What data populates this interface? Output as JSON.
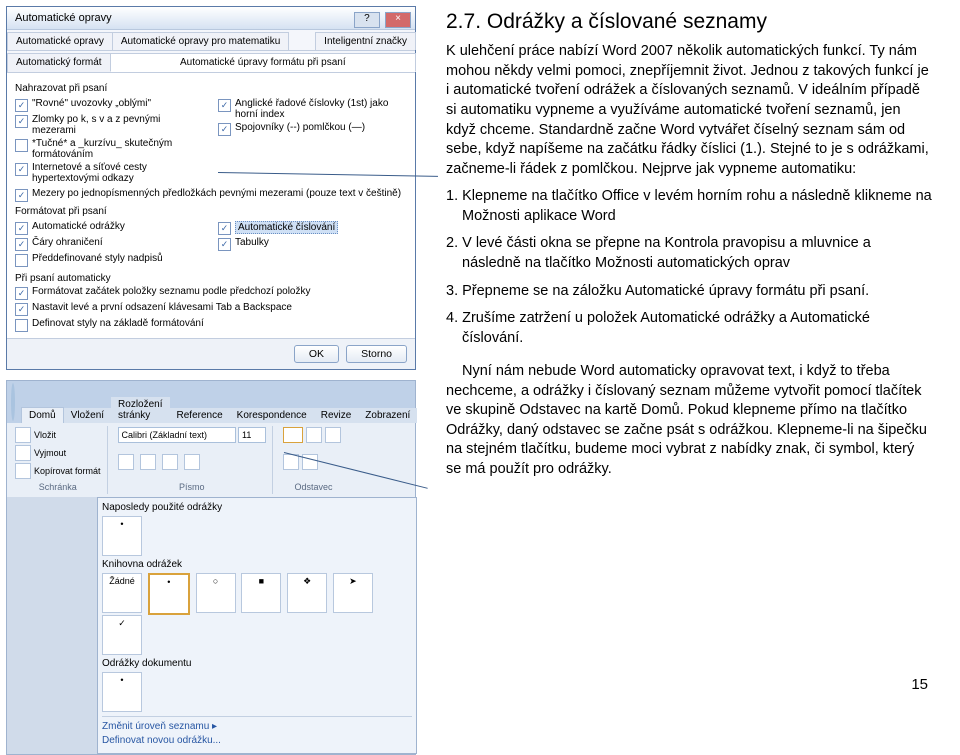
{
  "heading": "2.7. Odrážky a číslované seznamy",
  "para1": "K ulehčení práce nabízí Word 2007 několik automatických funkcí. Ty nám mohou někdy velmi pomoci, znepříjemnit život. Jednou z takových funkcí je i automatické tvoření odrážek a číslovaných seznamů. V ideálním případě si automatiku vypneme a využíváme automatické tvoření seznamů, jen když chceme. Standardně začne Word vytvářet číselný seznam sám od sebe, když napíšeme na začátku řádky číslici (1.). Stejné to je s odrážkami, začneme-li řádek z pomlčkou. Nejprve jak vypneme automatiku:",
  "step1": "1. Klepneme na tlačítko Office v levém horním rohu a následně klikneme na Možnosti aplikace Word",
  "step2": "2. V levé části okna se přepne na Kontrola pravopisu a mluvnice a následně na tlačítko Možnosti automatických oprav",
  "step3": "3. Přepneme se na záložku Automatické úpravy formátu při psaní.",
  "step4": "4. Zrušíme zatržení u položek Automatické odrážky a Automatické číslování.",
  "para2": "Nyní nám nebude Word automaticky opravovat text, i když to třeba nechceme, a odrážky i číslovaný seznam můžeme vytvořit pomocí tlačítek ve skupině Odstavec na kartě Domů. Pokud klepneme přímo na tlačítko Odrážky, daný odstavec se začne psát s odrážkou. Klepneme-li na šipečku na stejném tlačítku, budeme moci vybrat z nabídky znak, či symbol, který se má použít pro odrážky.",
  "page_number": "15",
  "dialog": {
    "title": "Automatické opravy",
    "tabs": [
      "Automatické opravy",
      "Automatické opravy pro matematiku",
      "Inteligentní značky"
    ],
    "wide_tab": "Automatický formát",
    "wide_tab2": "Automatické úpravy formátu při psaní",
    "section_replace": "Nahrazovat při psaní",
    "chk_rovne": "\"Rovné\" uvozovky „oblými\"",
    "chk_anglicke": "Anglické řadové číslovky (1st) jako horní index",
    "chk_zlomky": "Zlomky po k, s v a z pevnými mezerami",
    "chk_spojovniky": "Spojovníky (--) pomlčkou (—)",
    "chk_tucne": "*Tučné* a _kurzívu_ skutečným formátováním",
    "chk_internet": "Internetové a síťové cesty hypertextovými odkazy",
    "chk_mezery": "Mezery po jednopísmenných předložkách pevnými mezerami (pouze text v češtině)",
    "section_format": "Formátovat při psaní",
    "chk_auto_odrazky": "Automatické odrážky",
    "chk_auto_cislovani": "Automatické číslování",
    "chk_cary": "Čáry ohraničení",
    "chk_tabulky": "Tabulky",
    "chk_predef": "Předdefinované styly nadpisů",
    "section_auto": "Při psaní automaticky",
    "chk_format_zacatek": "Formátovat začátek položky seznamu podle předchozí položky",
    "chk_nastavit": "Nastavit levé a první odsazení klávesami Tab a Backspace",
    "chk_definovat": "Definovat styly na základě formátování",
    "btn_ok": "OK",
    "btn_cancel": "Storno"
  },
  "ribbon": {
    "tabs": [
      "Domů",
      "Vložení",
      "Rozložení stránky",
      "Reference",
      "Korespondence",
      "Revize",
      "Zobrazení"
    ],
    "clipboard_label": "Schránka",
    "font_label": "Písmo",
    "para_label": "Odstavec",
    "paste": "Vložit",
    "cut": "Vyjmout",
    "copy": "Kopírovat formát",
    "font": "Calibri (Základní text)",
    "size": "11"
  },
  "bullets": {
    "recent": "Naposledy použité odrážky",
    "library": "Knihovna odrážek",
    "none": "Žádné",
    "doc_bullets": "Odrážky dokumentu",
    "change_level": "Změnit úroveň seznamu",
    "define_new": "Definovat novou odrážku..."
  }
}
